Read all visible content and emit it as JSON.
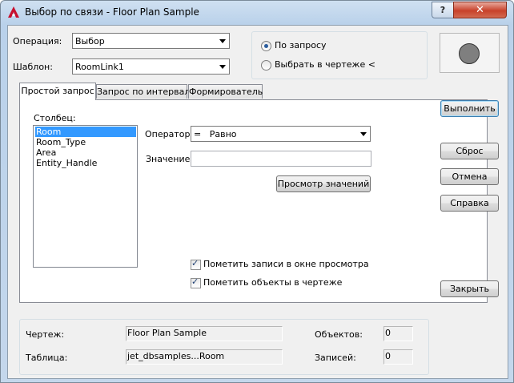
{
  "window": {
    "title": "Выбор по связи - Floor Plan Sample",
    "help_glyph": "?",
    "close_glyph": "✕"
  },
  "operation": {
    "label": "Операция:",
    "value": "Выбор"
  },
  "template": {
    "label": "Шаблон:",
    "value": "RoomLink1"
  },
  "mode": {
    "option1": "По запросу",
    "option2": "Выбрать в чертеже <",
    "selected": "option1"
  },
  "tabs": [
    {
      "label": "Простой запрос",
      "active": true
    },
    {
      "label": "Запрос по интервалу",
      "active": false
    },
    {
      "label": "Формирователь",
      "active": false
    }
  ],
  "column": {
    "label": "Столбец:",
    "items": [
      "Room",
      "Room_Type",
      "Area",
      "Entity_Handle"
    ],
    "selected": 0
  },
  "operator": {
    "label": "Оператор:",
    "value": "=   Равно"
  },
  "value_field": {
    "label": "Значение:",
    "value": ""
  },
  "view_values_button": "Просмотр значений",
  "checks": [
    {
      "label": "Пометить записи в окне просмотра",
      "checked": true
    },
    {
      "label": "Пометить объекты в чертеже",
      "checked": true
    }
  ],
  "buttons": {
    "execute": "Выполнить",
    "reset": "Сброс",
    "cancel": "Отмена",
    "help": "Справка",
    "close": "Закрыть"
  },
  "status": {
    "drawing_label": "Чертеж:",
    "drawing_value": "Floor Plan Sample",
    "table_label": "Таблица:",
    "table_value": "jet_dbsamples...Room",
    "objects_label": "Объектов:",
    "objects_value": "0",
    "records_label": "Записей:",
    "records_value": "0"
  }
}
